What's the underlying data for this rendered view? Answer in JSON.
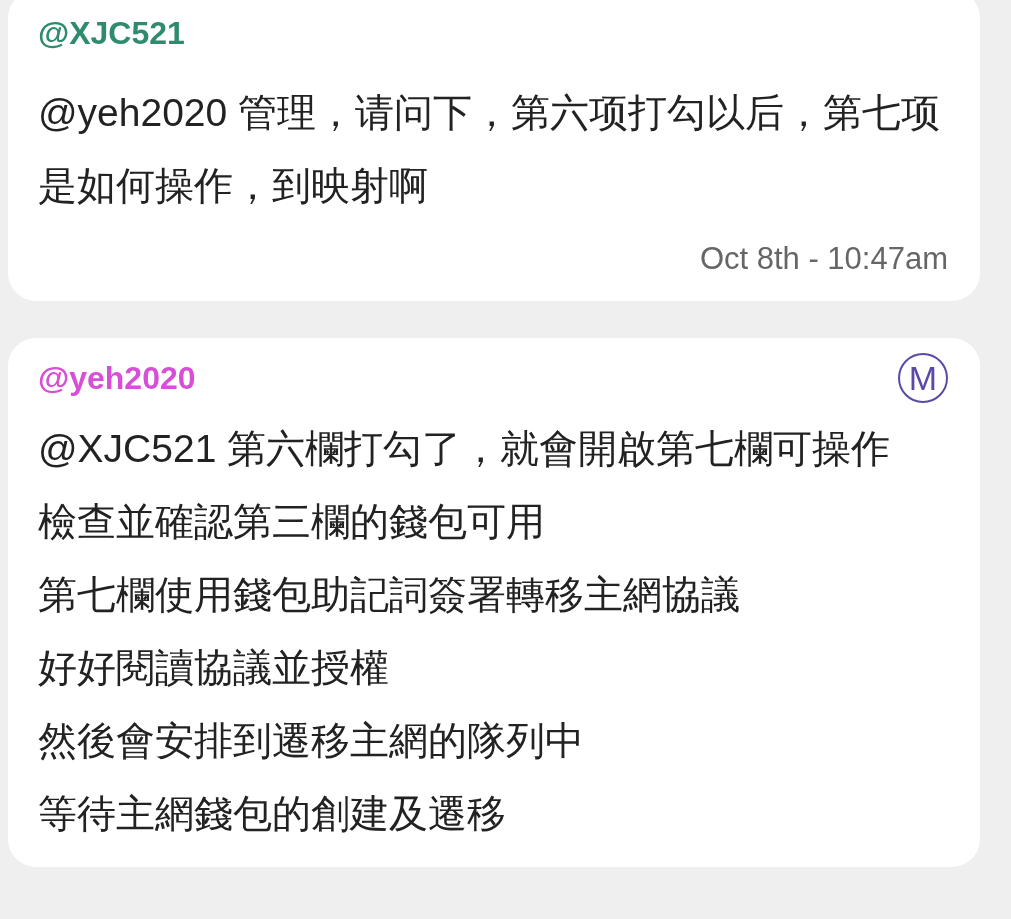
{
  "messages": [
    {
      "author": "@XJC521",
      "color": "#2e8c6a",
      "paragraphs": [
        "@yeh2020 管理，请问下，第六项打勾以后，第七项是如何操作，到映射啊"
      ],
      "time": "Oct 8th - 10:47am"
    },
    {
      "author": "@yeh2020",
      "color": "#d64fd6",
      "badge": "M",
      "paragraphs": [
        "@XJC521 第六欄打勾了，就會開啟第七欄可操作",
        "檢查並確認第三欄的錢包可用",
        "第七欄使用錢包助記詞簽署轉移主網協議",
        "好好閱讀協議並授權",
        "然後會安排到遷移主網的隊列中",
        "等待主網錢包的創建及遷移"
      ]
    }
  ]
}
